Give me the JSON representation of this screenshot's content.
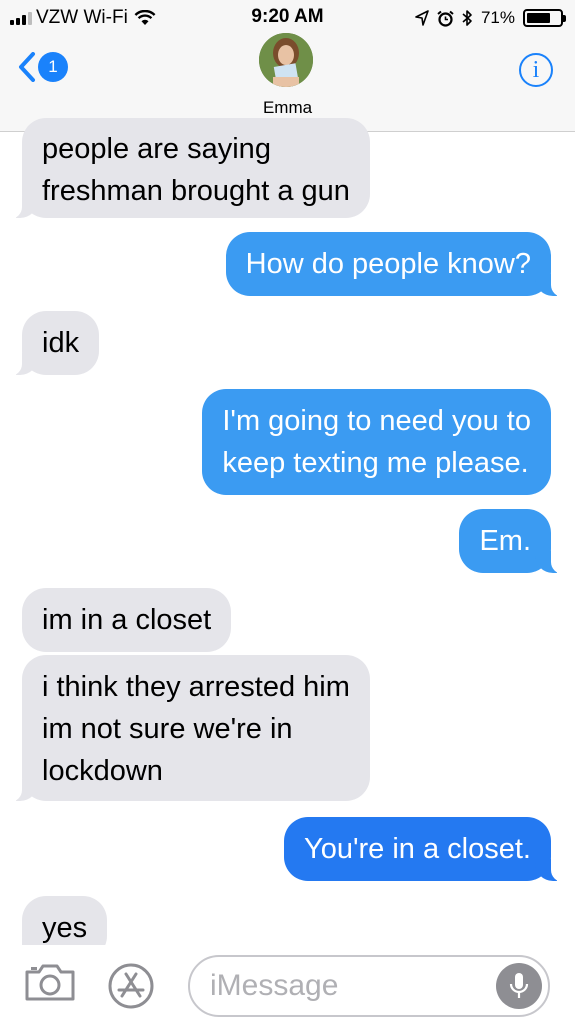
{
  "status": {
    "carrier": "VZW Wi-Fi",
    "time": "9:20 AM",
    "battery_pct": "71%",
    "battery_level": 0.71
  },
  "nav": {
    "back_badge": "1",
    "contact_name": "Emma",
    "info_glyph": "i"
  },
  "messages": [
    {
      "direction": "in",
      "lines": [
        "people are saying",
        "freshman brought a gun"
      ]
    },
    {
      "direction": "out",
      "lines": [
        "How do people know?"
      ]
    },
    {
      "direction": "in",
      "lines": [
        "idk"
      ]
    },
    {
      "direction": "out",
      "lines": [
        "I'm going to need you to",
        "keep texting me please."
      ]
    },
    {
      "direction": "out",
      "lines": [
        "Em."
      ]
    },
    {
      "direction": "in",
      "lines": [
        "im in a closet"
      ]
    },
    {
      "direction": "in",
      "lines": [
        "i think they arrested him",
        "im not sure we're in",
        "lockdown"
      ]
    },
    {
      "direction": "out",
      "lines": [
        "You're in a closet."
      ]
    },
    {
      "direction": "in",
      "lines": [
        "yes"
      ]
    }
  ],
  "input": {
    "placeholder": "iMessage"
  },
  "icons": {
    "signal": "signal-bars-icon",
    "wifi": "wifi-icon",
    "location": "location-arrow-icon",
    "alarm": "alarm-clock-icon",
    "bluetooth": "bluetooth-icon",
    "battery": "battery-icon",
    "back": "chevron-left-icon",
    "info": "info-icon",
    "camera": "camera-icon",
    "apps": "app-store-icon",
    "mic": "microphone-icon"
  },
  "colors": {
    "accent": "#1a82fb",
    "incoming_bubble": "#e5e5ea",
    "outgoing_bubble": "#3b9bf2"
  }
}
